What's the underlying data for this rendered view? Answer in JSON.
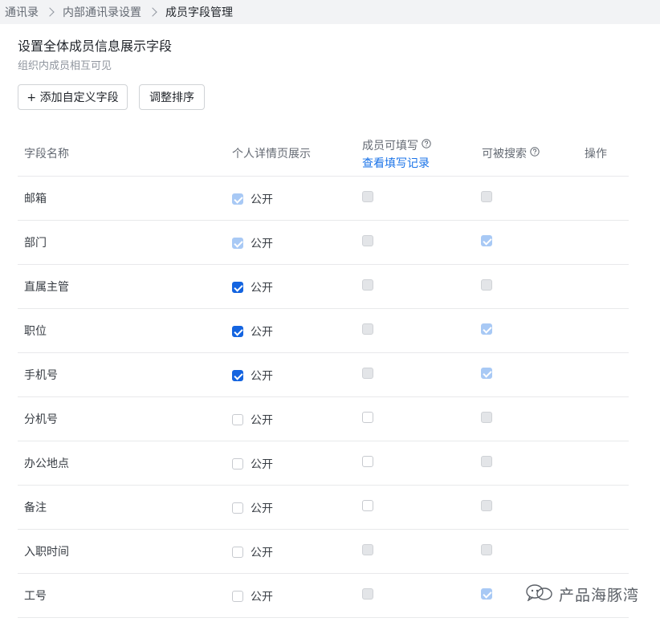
{
  "breadcrumb": {
    "items": [
      "通讯录",
      "内部通讯录设置",
      "成员字段管理"
    ]
  },
  "header": {
    "title": "设置全体成员信息展示字段",
    "subtitle": "组织内成员相互可见"
  },
  "toolbar": {
    "add_label": "+ 添加自定义字段",
    "sort_label": "调整排序"
  },
  "table": {
    "columns": {
      "name": "字段名称",
      "detail": "个人详情页展示",
      "fill": "成员可填写",
      "fill_link": "查看填写记录",
      "search": "可被搜索",
      "operation": "操作"
    },
    "public_label": "公开",
    "rows": [
      {
        "name": "邮箱",
        "detail": "disabled-checked",
        "fill": "disabled-unchecked",
        "search": "disabled-unchecked"
      },
      {
        "name": "部门",
        "detail": "disabled-checked",
        "fill": "disabled-unchecked",
        "search": "disabled-checked"
      },
      {
        "name": "直属主管",
        "detail": "checked",
        "fill": "disabled-unchecked",
        "search": "disabled-unchecked"
      },
      {
        "name": "职位",
        "detail": "checked",
        "fill": "disabled-unchecked",
        "search": "disabled-checked"
      },
      {
        "name": "手机号",
        "detail": "checked",
        "fill": "disabled-unchecked",
        "search": "disabled-checked"
      },
      {
        "name": "分机号",
        "detail": "unchecked",
        "fill": "unchecked",
        "search": "disabled-unchecked"
      },
      {
        "name": "办公地点",
        "detail": "unchecked",
        "fill": "unchecked",
        "search": "disabled-unchecked"
      },
      {
        "name": "备注",
        "detail": "unchecked",
        "fill": "unchecked",
        "search": "disabled-unchecked"
      },
      {
        "name": "入职时间",
        "detail": "unchecked",
        "fill": "disabled-unchecked",
        "search": "disabled-unchecked"
      },
      {
        "name": "工号",
        "detail": "unchecked",
        "fill": "disabled-unchecked",
        "search": "disabled-checked"
      }
    ]
  },
  "watermark": {
    "icon": "wechat-icon",
    "text": "产品海豚湾"
  },
  "colors": {
    "accent": "#1464e0",
    "link": "#1a73e8",
    "disabled_checked": "#a8c9f5",
    "breadcrumb_bg": "#f2f3f5"
  }
}
